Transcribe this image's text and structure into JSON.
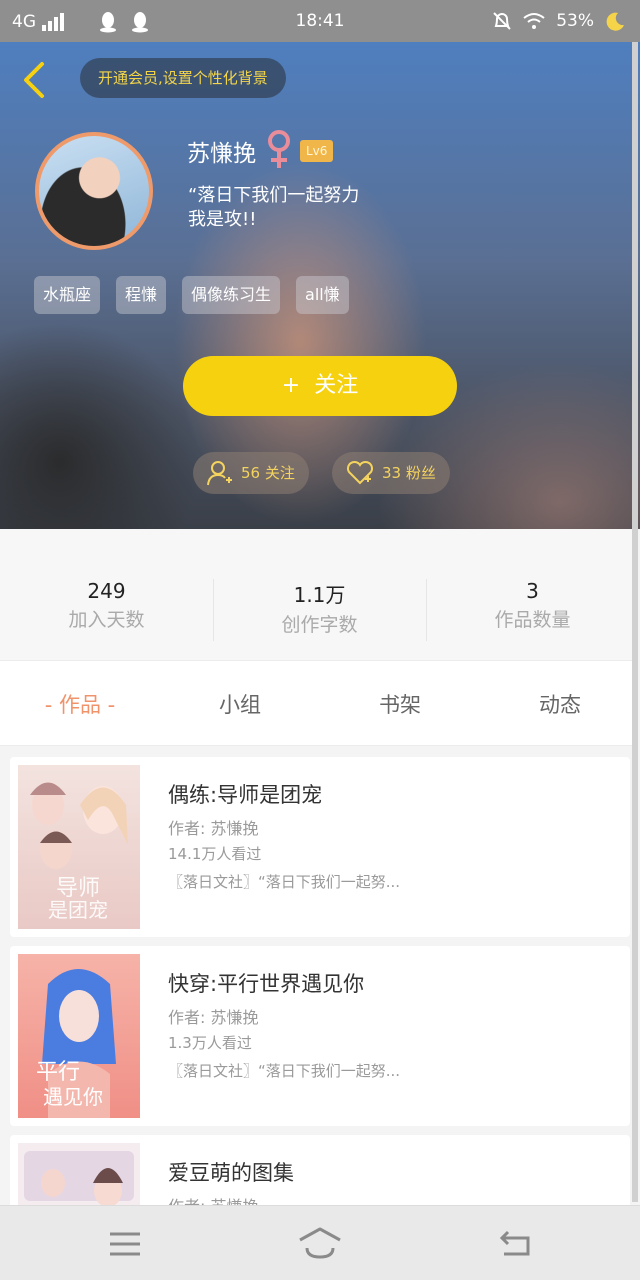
{
  "status_bar": {
    "network": "4G",
    "time": "18:41",
    "battery": "53%",
    "icon_names": [
      "signal-icon",
      "qq-icon",
      "qq-icon",
      "mute-icon",
      "wifi-icon",
      "moon-icon"
    ]
  },
  "header": {
    "vip_prompt": "开通会员,设置个性化背景"
  },
  "profile": {
    "name": "苏慊挽",
    "level": "Lv6",
    "bio": "“落日下我们一起努力\n我是攻!!",
    "tags": [
      "水瓶座",
      "程慊",
      "偶像练习生",
      "all慊"
    ],
    "follow_button": "关注",
    "following": "56 关注",
    "fans": "33 粉丝"
  },
  "stats": [
    {
      "value": "249",
      "label": "加入天数"
    },
    {
      "value": "1.1万",
      "label": "创作字数"
    },
    {
      "value": "3",
      "label": "作品数量"
    }
  ],
  "tabs": [
    {
      "label": "- 作品 -",
      "active": true
    },
    {
      "label": "小组",
      "active": false
    },
    {
      "label": "书架",
      "active": false
    },
    {
      "label": "动态",
      "active": false
    }
  ],
  "books": [
    {
      "title": "偶练:导师是团宠",
      "author": "作者: 苏慊挽",
      "views": "14.1万人看过",
      "desc": "〖落日文社〗“落日下我们一起努..."
    },
    {
      "title": "快穿:平行世界遇见你",
      "author": "作者: 苏慊挽",
      "views": "1.3万人看过",
      "desc": "〖落日文社〗“落日下我们一起努..."
    },
    {
      "title": "爱豆萌的图集",
      "author": "作者: 苏慊挽",
      "views": "",
      "desc": ""
    }
  ],
  "colors": {
    "accent": "#f5d10f",
    "tab_active": "#f0936a",
    "avatar_border": "#ef9a6b"
  }
}
